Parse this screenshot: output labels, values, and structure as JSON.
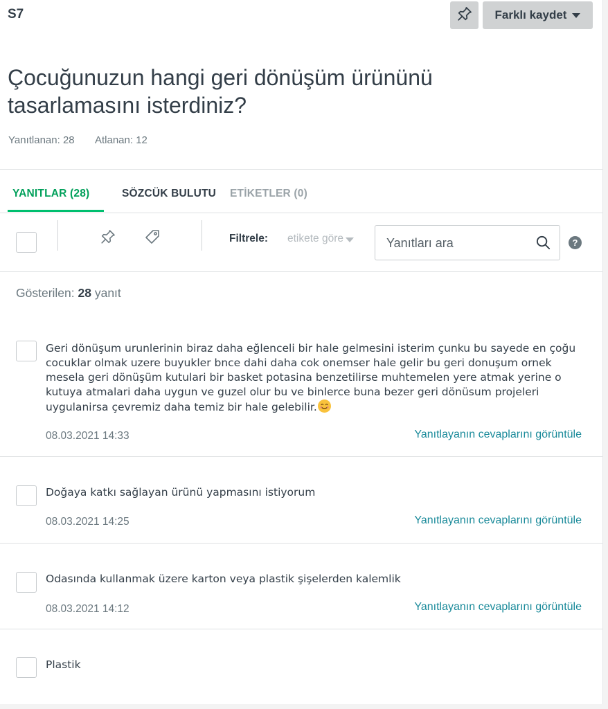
{
  "question": {
    "number": "S7",
    "title_line1": "Çocuğunuzun hangi geri dönüşüm ürününü",
    "title_line2": "tasarlamasını isterdiniz?",
    "answered": "Yanıtlanan: 28",
    "skipped": "Atlanan: 12"
  },
  "header": {
    "save_as_label": "Farklı kaydet"
  },
  "tabs": [
    {
      "label": "YANITLAR (28)",
      "state": "active"
    },
    {
      "label": "SÖZCÜK BULUTU",
      "state": "normal"
    },
    {
      "label": "ETİKETLER (0)",
      "state": "disabled"
    }
  ],
  "toolbar": {
    "filter_label": "Filtrele:",
    "filter_value": "etikete göre",
    "search_placeholder": "Yanıtları ara",
    "help": "?"
  },
  "summary": {
    "prefix": "Gösterilen:",
    "count": "28",
    "suffix": "yanıt"
  },
  "responses": [
    {
      "lines": [
        "Geri dönüşum urunlerinin biraz daha eğlenceli bir hale gelmesini isterim çunku bu sayede en çoğu",
        "cocuklar olmak uzere buyukler bnce dahi daha cok onemser hale gelir bu geri donuşum ornek",
        "mesela geri dönüşüm kutulari bir basket potasina benzetilirse muhtemelen yere atmak yerine o",
        "kutuya atmalari daha uygun ve guzel olur bu ve binlerce buna bezer geri dönüsum projeleri",
        "uygulanirsa çevremiz daha temiz bir hale gelebilir."
      ],
      "emoji": "smiling-face-emoji",
      "date": "08.03.2021 14:33",
      "link": "Yanıtlayanın cevaplarını görüntüle"
    },
    {
      "lines": [
        "Doğaya katkı sağlayan ürünü yapmasını istiyorum"
      ],
      "date": "08.03.2021 14:25",
      "link": "Yanıtlayanın cevaplarını görüntüle"
    },
    {
      "lines": [
        "Odasında kullanmak üzere karton veya plastik şişelerden kalemlik"
      ],
      "date": "08.03.2021 14:12",
      "link": "Yanıtlayanın cevaplarını görüntüle"
    },
    {
      "lines": [
        "Plastik"
      ]
    }
  ],
  "colors": {
    "accent": "#00bf6f",
    "link": "#1a8a9a",
    "button_bg": "#d0d2d3"
  }
}
